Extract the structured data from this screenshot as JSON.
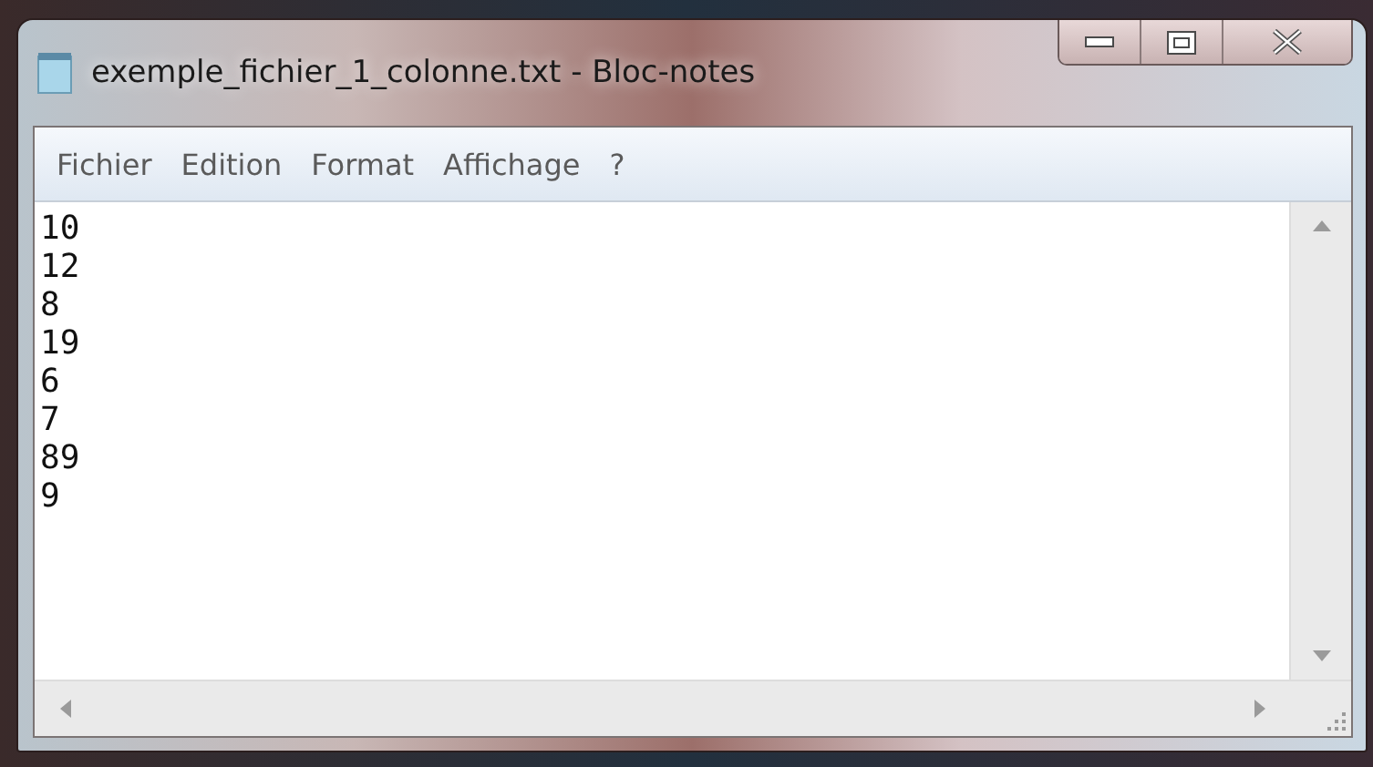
{
  "window": {
    "title": "exemple_fichier_1_colonne.txt - Bloc-notes"
  },
  "menu": [
    {
      "label": "Fichier"
    },
    {
      "label": "Edition"
    },
    {
      "label": "Format"
    },
    {
      "label": "Affichage"
    },
    {
      "label": "?"
    }
  ],
  "editor": {
    "lines": [
      "10",
      "12",
      "8",
      "19",
      "6",
      "7",
      "89",
      "9"
    ]
  }
}
